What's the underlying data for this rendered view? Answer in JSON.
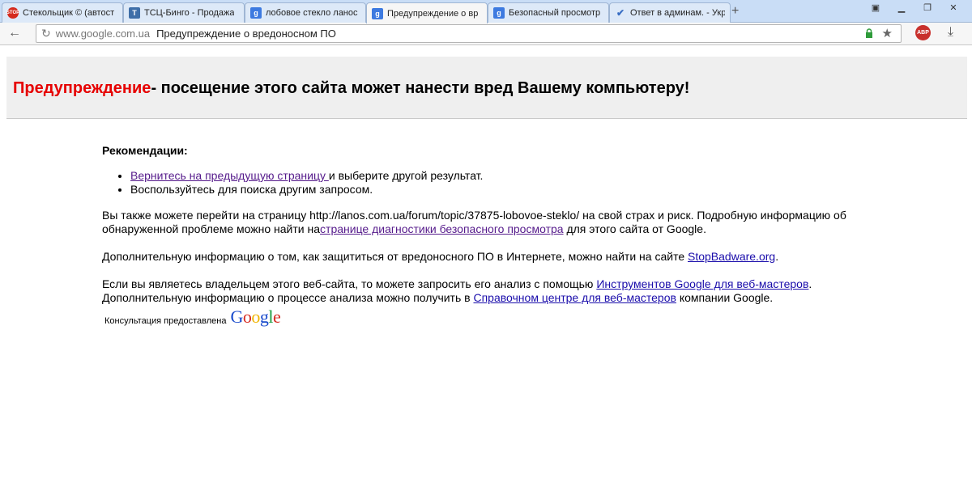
{
  "tabs": [
    {
      "title": "Стекольщик © (автост",
      "icon": "stop-icon"
    },
    {
      "title": "ТСЦ-Бинго - Продажа",
      "icon": "tsc-icon"
    },
    {
      "title": "лобовое стекло ланос",
      "icon": "google-icon"
    },
    {
      "title": "Предупреждение о вр",
      "icon": "google-icon",
      "active": true
    },
    {
      "title": "Безопасный просмотр",
      "icon": "google-icon"
    },
    {
      "title": "Ответ в админам. - Укр",
      "icon": "check-icon"
    }
  ],
  "toolbar": {
    "domain": "www.google.com.ua",
    "page_title": "Предупреждение о вредоносном ПО",
    "abp_label": "ABP"
  },
  "banner": {
    "warning": "Предупреждение",
    "rest": "- посещение этого сайта может нанести вред Вашему компьютеру!"
  },
  "content": {
    "heading": "Рекомендации:",
    "item1_link": "Вернитесь на предыдущую страницу ",
    "item1_rest": "и выберите другой результат.",
    "item2": "Воспользуйтесь для поиска другим запросом.",
    "p1_start": "Вы также можете перейти на страницу http://lanos.com.ua/forum/topic/37875-lobovoe-steklo/ на свой страх и риск. Подробную информацию об обнаруженной проблеме можно найти на",
    "p1_link": "странице диагностики безопасного просмотра",
    "p1_end": " для этого сайта от Google.",
    "p2_start": "Дополнительную информацию о том, как защититься от вредоносного ПО в Интернете, можно найти на сайте ",
    "p2_link": "StopBadware.org",
    "p2_end": ".",
    "p3_start": "Если вы являетесь владельцем этого веб-сайта, то можете запросить его анализ с помощью ",
    "p3_link1": "Инструментов Google для веб-мастеров",
    "p3_mid": ". Дополнительную информацию о процессе анализа можно получить в ",
    "p3_link2": "Справочном центре для веб-мастеров",
    "p3_end": " компании Google."
  },
  "footer": {
    "label": "Консультация предоставлена",
    "logo_letters": [
      "G",
      "o",
      "o",
      "g",
      "l",
      "e"
    ]
  }
}
